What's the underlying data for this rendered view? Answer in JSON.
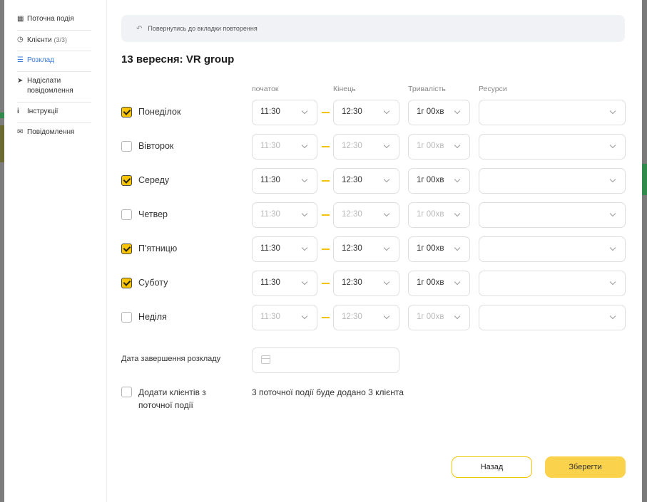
{
  "sidebar": {
    "items": [
      {
        "label": "Поточна подія",
        "icon": "calendar-icon",
        "count": ""
      },
      {
        "label": "Клієнти",
        "icon": "clock-icon",
        "count": "(3/3)"
      },
      {
        "label": "Розклад",
        "icon": "list-icon",
        "count": ""
      },
      {
        "label": "Надіслати повідомлення",
        "icon": "send-icon",
        "count": ""
      },
      {
        "label": "Інструкції",
        "icon": "info-icon",
        "count": ""
      },
      {
        "label": "Повідомлення",
        "icon": "chat-icon",
        "count": ""
      }
    ],
    "active": "Розклад"
  },
  "back_bar": {
    "label": "Повернутись до вкладки повторення"
  },
  "title": "13 вересня: VR group",
  "columns": {
    "start": "початок",
    "end": "Кінець",
    "duration": "Тривалість",
    "resources": "Ресурси"
  },
  "days": [
    {
      "name": "Понеділок",
      "checked": true,
      "start": "11:30",
      "end": "12:30",
      "duration": "1г 00хв",
      "resource": ""
    },
    {
      "name": "Вівторок",
      "checked": false,
      "start": "11:30",
      "end": "12:30",
      "duration": "1г 00хв",
      "resource": ""
    },
    {
      "name": "Середу",
      "checked": true,
      "start": "11:30",
      "end": "12:30",
      "duration": "1г 00хв",
      "resource": ""
    },
    {
      "name": "Четвер",
      "checked": false,
      "start": "11:30",
      "end": "12:30",
      "duration": "1г 00хв",
      "resource": ""
    },
    {
      "name": "П'ятницю",
      "checked": true,
      "start": "11:30",
      "end": "12:30",
      "duration": "1г 00хв",
      "resource": ""
    },
    {
      "name": "Суботу",
      "checked": true,
      "start": "11:30",
      "end": "12:30",
      "duration": "1г 00хв",
      "resource": ""
    },
    {
      "name": "Неділя",
      "checked": false,
      "start": "11:30",
      "end": "12:30",
      "duration": "1г 00хв",
      "resource": ""
    }
  ],
  "end_date": {
    "label": "Дата завершення розкладу",
    "value": ""
  },
  "add_clients": {
    "label": "Додати клієнтів з поточної події",
    "checked": false,
    "note": "3 поточної події буде додано 3 клієнта"
  },
  "buttons": {
    "back": "Назад",
    "save": "Зберегти"
  },
  "colors": {
    "accent": "#f9c400",
    "active_link": "#3b7ddd"
  }
}
